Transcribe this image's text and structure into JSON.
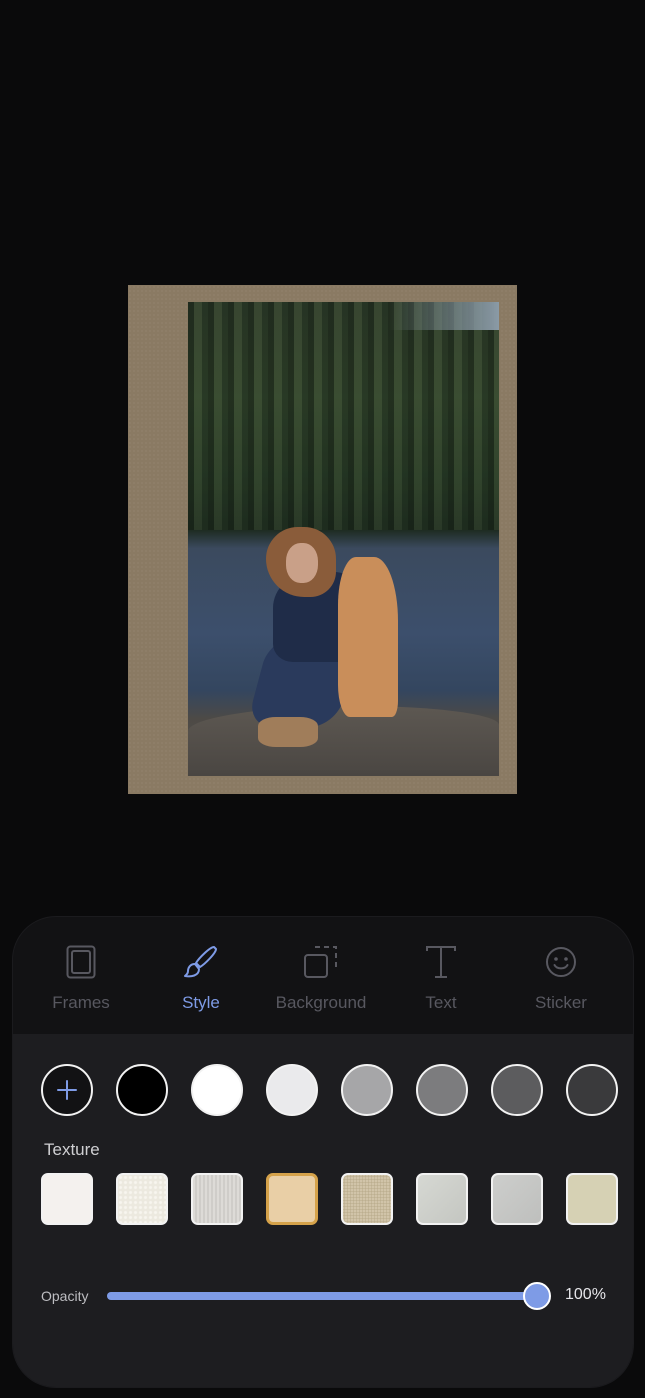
{
  "tabs": [
    {
      "label": "Frames",
      "icon": "frame-icon",
      "active": false
    },
    {
      "label": "Style",
      "icon": "brush-icon",
      "active": true
    },
    {
      "label": "Background",
      "icon": "background-icon",
      "active": false
    },
    {
      "label": "Text",
      "icon": "text-icon",
      "active": false
    },
    {
      "label": "Sticker",
      "icon": "smiley-icon",
      "active": false
    }
  ],
  "colors": {
    "add_icon": "plus-icon",
    "swatches": [
      "#000000",
      "#ffffff",
      "#eaeaec",
      "#a6a6a8",
      "#7c7c7e",
      "#5c5c5e",
      "#3a3a3c"
    ]
  },
  "texture": {
    "title": "Texture",
    "swatches": [
      "#f4f1ee",
      "#f3f1ea",
      "#dcdad6",
      "#e9cfa6",
      "#cfc3a8",
      "#cfd1cc",
      "#c6c7c5",
      "#d6d1b4"
    ],
    "selected_index": 3
  },
  "opacity": {
    "label": "Opacity",
    "value_text": "100%",
    "value": 1.0
  },
  "colors_theme": {
    "accent": "#7e9be6",
    "frame": "#8a7a63",
    "selected_texture_border": "#d5a24a"
  }
}
